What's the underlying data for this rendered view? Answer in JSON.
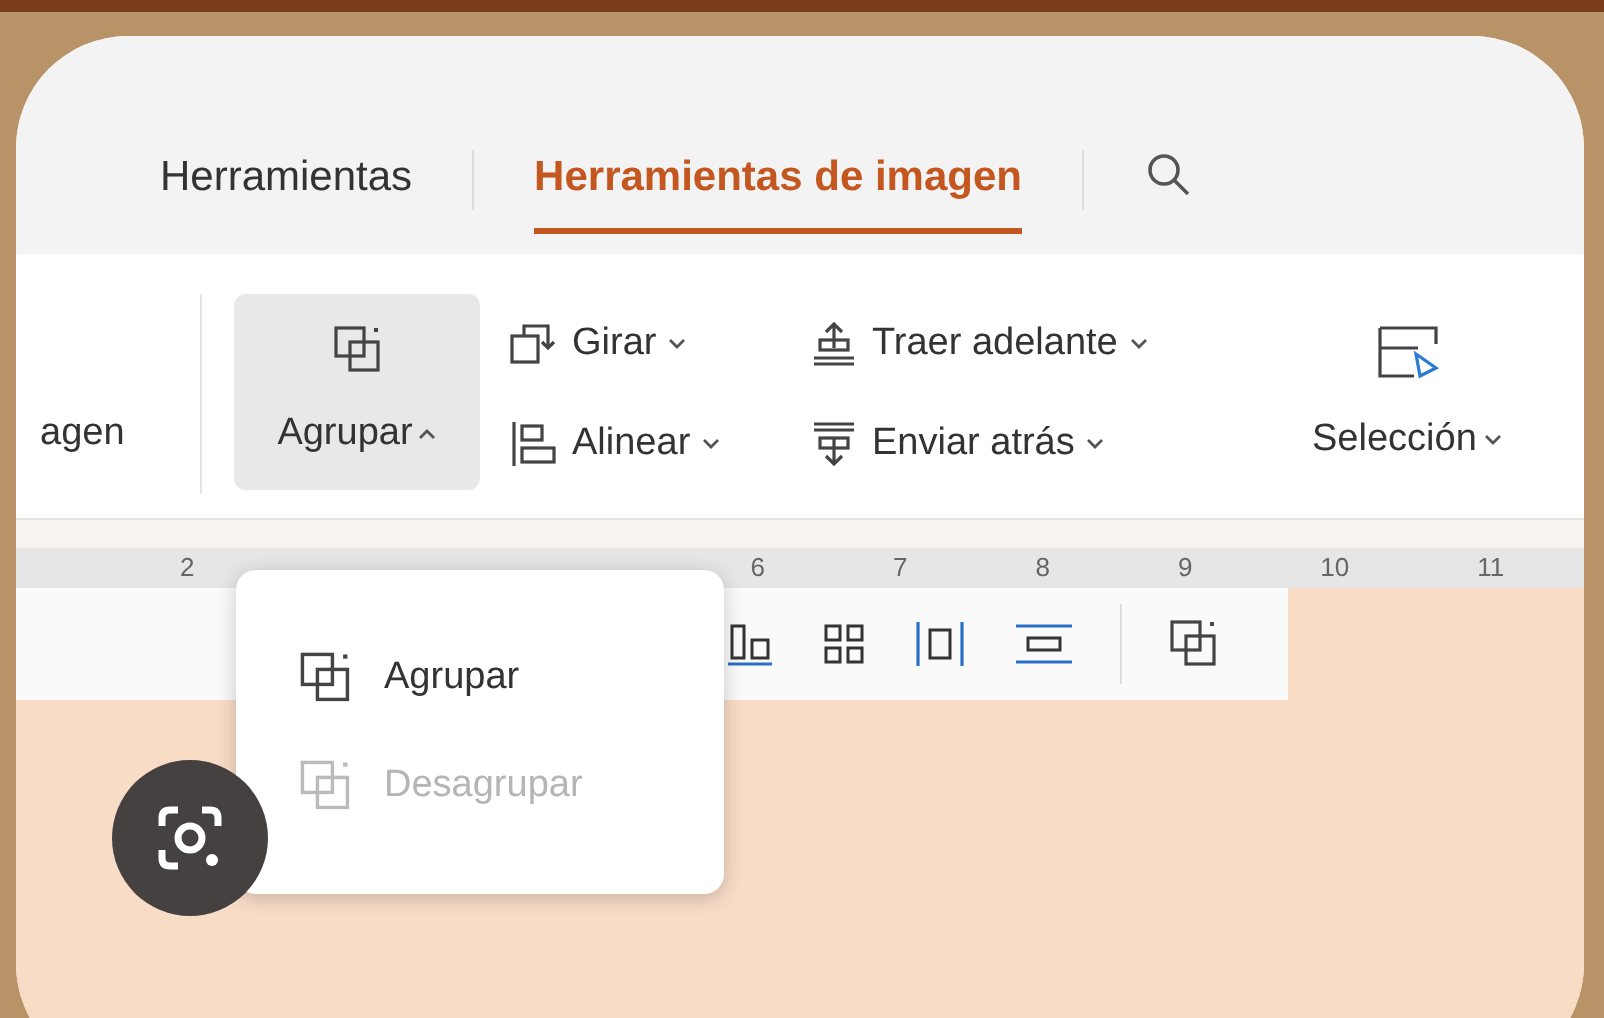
{
  "tabs": [
    {
      "label": "Herramientas",
      "selected": false
    },
    {
      "label": "Herramientas de imagen",
      "selected": true
    }
  ],
  "ribbon": {
    "cut_label": "agen",
    "group_button": {
      "label": "Agrupar",
      "expanded": true
    },
    "small_buttons": [
      {
        "label": "Girar",
        "kind": "rotate"
      },
      {
        "label": "Alinear",
        "kind": "align"
      },
      {
        "label": "Traer adelante",
        "kind": "forward"
      },
      {
        "label": "Enviar atrás",
        "kind": "backward"
      }
    ],
    "selection_button": {
      "label": "Selección"
    }
  },
  "menu": [
    {
      "label": "Agrupar",
      "disabled": false
    },
    {
      "label": "Desagrupar",
      "disabled": true
    }
  ],
  "ruler": [
    "2",
    "6",
    "7",
    "8",
    "9",
    "10",
    "11"
  ]
}
